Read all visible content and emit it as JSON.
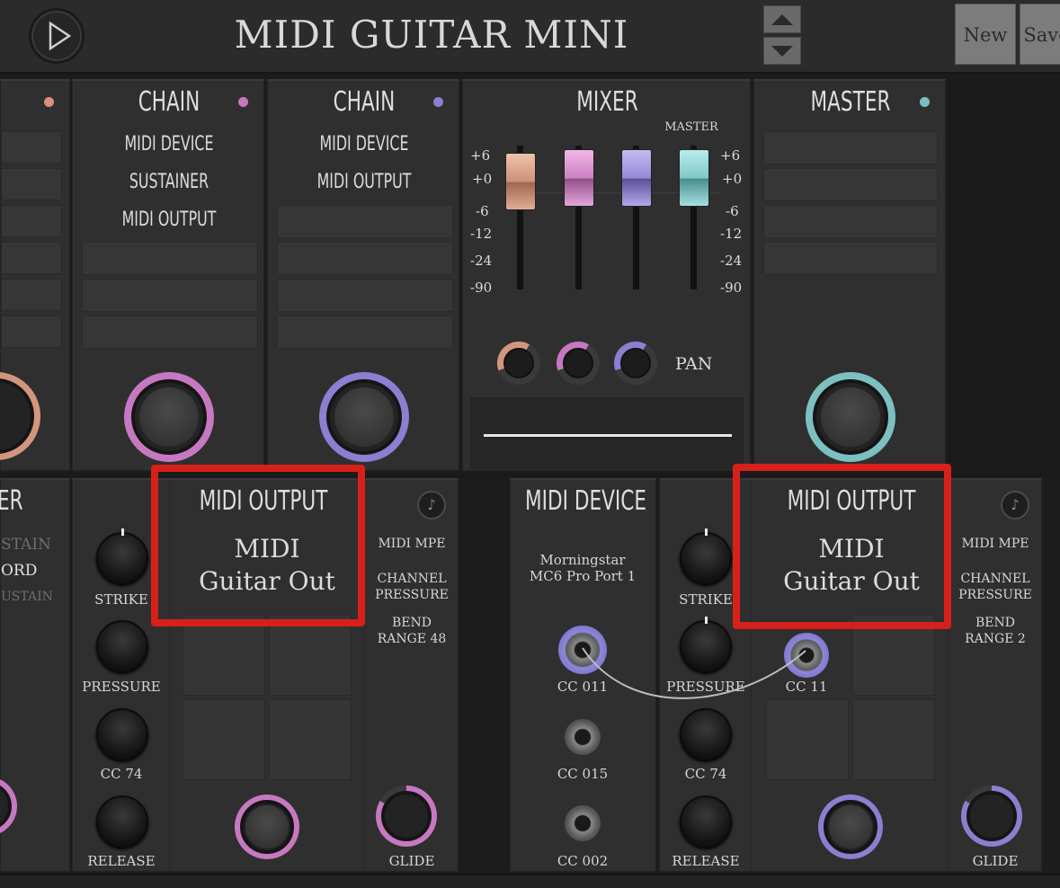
{
  "header": {
    "title": "MIDI GUITAR MINI",
    "new_label": "New",
    "save_label": "Save"
  },
  "top_row": {
    "chain1": {
      "title": "CHAIN",
      "items": [
        "MIDI DEVICE",
        "SUSTAINER",
        "MIDI OUTPUT"
      ],
      "color": "#c678c0"
    },
    "chain2": {
      "title": "CHAIN",
      "items": [
        "MIDI DEVICE",
        "MIDI OUTPUT"
      ],
      "color": "#8a7fd0"
    },
    "mixer": {
      "title": "MIXER",
      "master_label": "MASTER",
      "scale_left": [
        "+6",
        "+0",
        "-6",
        "-12",
        "-24",
        "-90"
      ],
      "scale_right": [
        "+6",
        "+0",
        "-6",
        "-12",
        "-24",
        "-90"
      ],
      "pan_label": "PAN"
    },
    "master": {
      "title": "MASTER",
      "color": "#7cc0c0"
    }
  },
  "bottom_left": {
    "knobs": [
      "STRIKE",
      "PRESSURE",
      "CC 74",
      "RELEASE"
    ],
    "output_title": "MIDI OUTPUT",
    "output_name_line1": "MIDI",
    "output_name_line2": "Guitar Out",
    "options": [
      "MIDI MPE",
      "CHANNEL PRESSURE",
      "BEND RANGE 48"
    ],
    "glide_label": "GLIDE",
    "partial_title": "ER",
    "partial_items": [
      "STAIN",
      "ORD",
      "USTAIN"
    ]
  },
  "bottom_right": {
    "device_title": "MIDI DEVICE",
    "device_name_line1": "Morningstar",
    "device_name_line2": "MC6 Pro Port 1",
    "ports": [
      "CC 011",
      "CC 015",
      "CC 002"
    ],
    "knobs": [
      "STRIKE",
      "PRESSURE",
      "CC 74",
      "RELEASE"
    ],
    "output_title": "MIDI OUTPUT",
    "output_name_line1": "MIDI",
    "output_name_line2": "Guitar Out",
    "output_port": "CC 11",
    "options": [
      "MIDI MPE",
      "CHANNEL PRESSURE",
      "BEND RANGE 2"
    ],
    "glide_label": "GLIDE"
  }
}
